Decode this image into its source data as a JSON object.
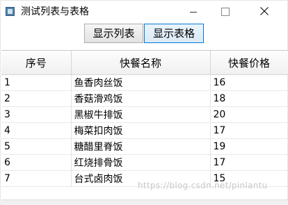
{
  "window": {
    "title": "测试列表与表格",
    "icon": "app-window-icon"
  },
  "toolbar": {
    "show_list_label": "显示列表",
    "show_table_label": "显示表格"
  },
  "table": {
    "headers": [
      "序号",
      "快餐名称",
      "快餐价格"
    ],
    "rows": [
      [
        "1",
        "鱼香肉丝饭",
        "16"
      ],
      [
        "2",
        "香菇滑鸡饭",
        "18"
      ],
      [
        "3",
        "黑椒牛排饭",
        "20"
      ],
      [
        "4",
        "梅菜扣肉饭",
        "17"
      ],
      [
        "5",
        "糖醋里脊饭",
        "19"
      ],
      [
        "6",
        "红烧排骨饭",
        "17"
      ],
      [
        "7",
        "台式卤肉饭",
        "15"
      ]
    ]
  },
  "watermark": "https://blog.csdn.net/pinlantu",
  "colors": {
    "active_button_border": "#0078d7",
    "button_border": "#adadad"
  }
}
